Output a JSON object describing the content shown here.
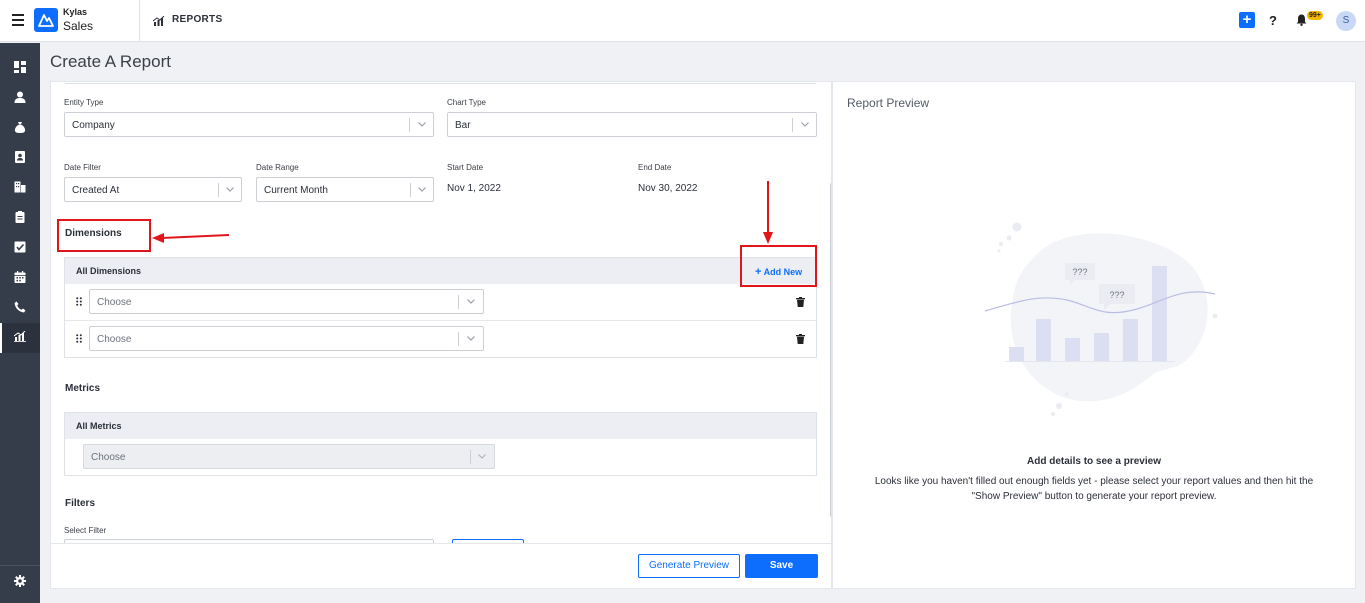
{
  "topbar": {
    "brand_top": "Kylas",
    "brand_bottom": "Sales",
    "section_label": "REPORTS",
    "help_label": "?",
    "notification_badge": "99+",
    "avatar_initial": "S"
  },
  "sidebar": {
    "items": [
      "dashboard",
      "contacts",
      "deals",
      "leads",
      "companies",
      "reports-clipboard",
      "tasks",
      "calendar",
      "calls",
      "reports"
    ],
    "active": "reports",
    "bottom": "settings"
  },
  "page": {
    "title": "Create A Report"
  },
  "form": {
    "entity_type": {
      "label": "Entity Type",
      "value": "Company"
    },
    "chart_type": {
      "label": "Chart Type",
      "value": "Bar"
    },
    "date_filter": {
      "label": "Date Filter",
      "value": "Created At"
    },
    "date_range": {
      "label": "Date Range",
      "value": "Current Month"
    },
    "start_date": {
      "label": "Start Date",
      "value": "Nov 1, 2022"
    },
    "end_date": {
      "label": "End Date",
      "value": "Nov 30, 2022"
    },
    "dimensions": {
      "title": "Dimensions",
      "header": "All Dimensions",
      "add_new": "Add New",
      "rows": [
        {
          "placeholder": "Choose"
        },
        {
          "placeholder": "Choose"
        }
      ]
    },
    "metrics": {
      "title": "Metrics",
      "header": "All Metrics",
      "rows": [
        {
          "placeholder": "Choose"
        }
      ]
    },
    "filters": {
      "title": "Filters",
      "select_label": "Select Filter"
    },
    "buttons": {
      "generate_preview": "Generate Preview",
      "save": "Save"
    }
  },
  "preview": {
    "title": "Report Preview",
    "bubble_1": "???",
    "bubble_2": "???",
    "empty_title": "Add details to see a preview",
    "empty_line_1": "Looks like you haven't filled out enough fields yet - please select your report values and then hit the",
    "empty_line_2": "\"Show Preview\" button to generate your report preview."
  },
  "colors": {
    "accent": "#0d6efd",
    "sidebar": "#353d4b",
    "annotation": "#e0161b",
    "badge": "#f5b700"
  }
}
